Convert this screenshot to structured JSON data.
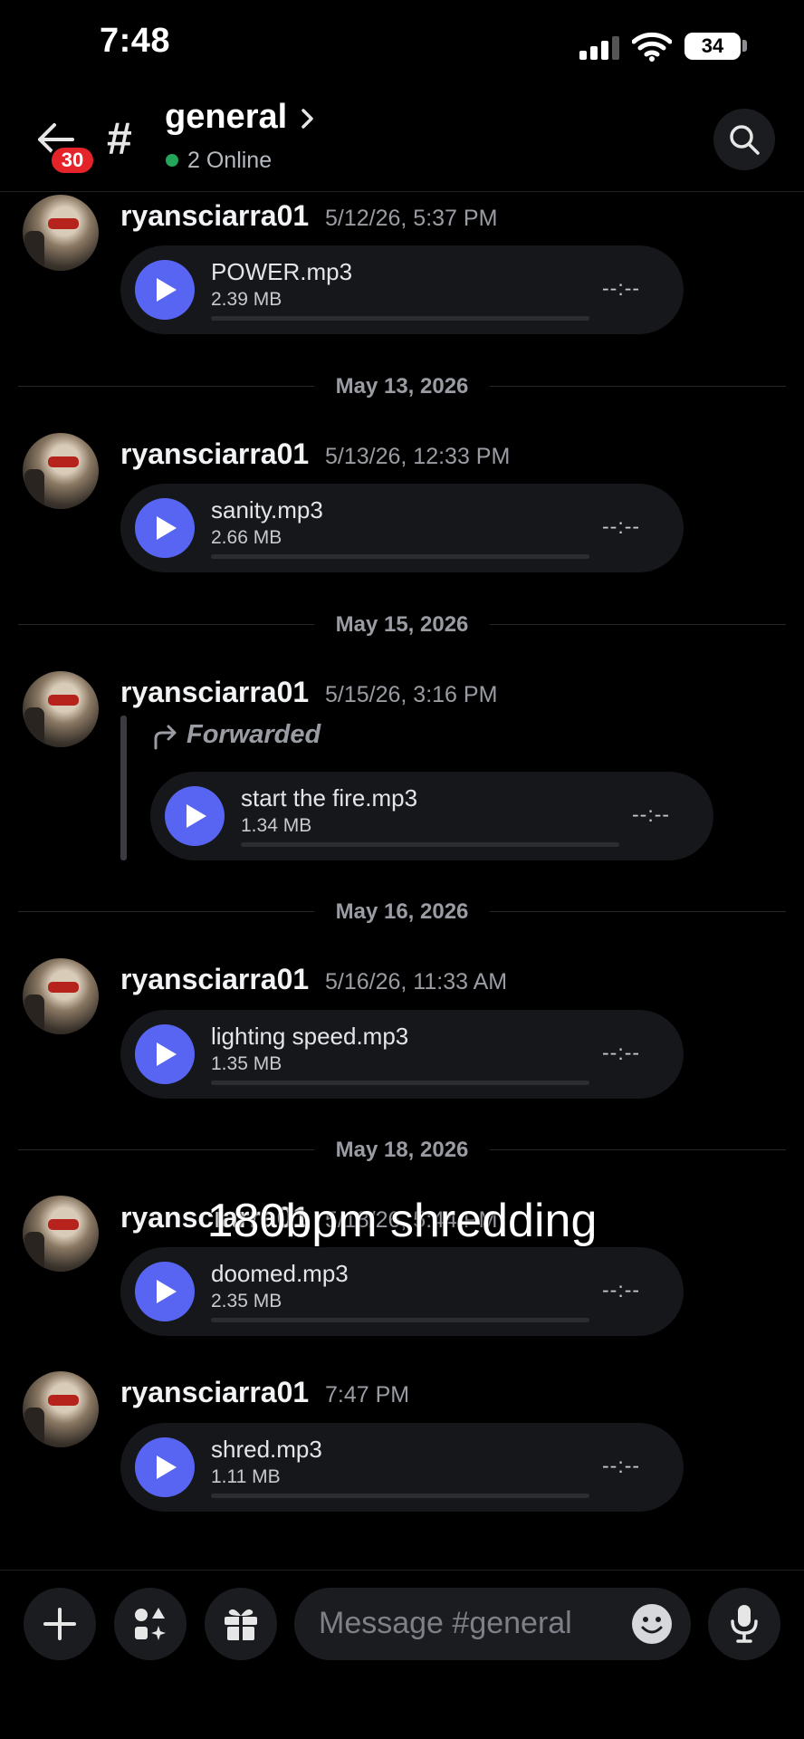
{
  "status_bar": {
    "time": "7:48",
    "battery": "34"
  },
  "header": {
    "unread_count": "30",
    "hash": "#",
    "channel": "general",
    "online": "2 Online"
  },
  "messages": [
    {
      "user": "ryansciarra01",
      "time": "5/12/26, 5:37 PM",
      "file": "POWER.mp3",
      "size": "2.39 MB",
      "duration": "--:--"
    },
    {
      "user": "ryansciarra01",
      "time": "5/13/26, 12:33 PM",
      "file": "sanity.mp3",
      "size": "2.66 MB",
      "duration": "--:--"
    },
    {
      "user": "ryansciarra01",
      "time": "5/15/26, 3:16 PM",
      "forwarded": "Forwarded",
      "file": "start the fire.mp3",
      "size": "1.34 MB",
      "duration": "--:--"
    },
    {
      "user": "ryansciarra01",
      "time": "5/16/26, 11:33 AM",
      "file": "lighting speed.mp3",
      "size": "1.35 MB",
      "duration": "--:--"
    },
    {
      "user": "ryansciarra01",
      "time": "5/18/26, 5:44 PM",
      "file": "doomed.mp3",
      "size": "2.35 MB",
      "duration": "--:--"
    },
    {
      "user": "ryansciarra01",
      "time": "7:47 PM",
      "file": "shred.mp3",
      "size": "1.11 MB",
      "duration": "--:--"
    }
  ],
  "date_dividers": [
    "May 13, 2026",
    "May 15, 2026",
    "May 16, 2026",
    "May 18, 2026"
  ],
  "overlay_caption": "180bpm shredding",
  "composer": {
    "placeholder": "Message #general"
  },
  "icons": {
    "back": "arrow-left-icon",
    "search": "search-icon",
    "add": "plus-icon",
    "apps": "apps-icon",
    "gift": "gift-icon",
    "emoji": "emoji-icon",
    "mic": "microphone-icon",
    "play": "play-icon",
    "forward": "forward-arrow-icon"
  },
  "colors": {
    "accent": "#5865f2",
    "badge": "#e5242a",
    "online": "#23a55a"
  }
}
